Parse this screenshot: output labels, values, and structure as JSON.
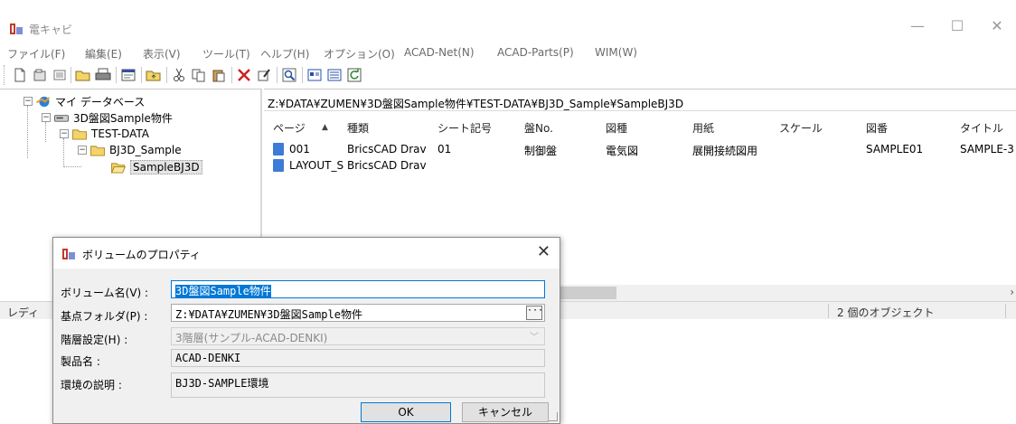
{
  "app": {
    "title": "電キャビ",
    "minimize": "—",
    "maximize": "☐",
    "close": "✕"
  },
  "menu": [
    "ファイル(F)",
    "編集(E)",
    "表示(V)",
    "ツール(T)",
    "ヘルプ(H)",
    "オプション(O)",
    "ACAD-Net(N)",
    "ACAD-Parts(P)",
    "WIM(W)"
  ],
  "toolbar_icons": [
    "new-file-icon",
    "open-icon",
    "list-icon",
    "open-folder-icon",
    "print-icon",
    "properties-icon",
    "folder-up-icon",
    "cut-icon",
    "copy-icon",
    "paste-icon",
    "delete-icon",
    "edit-properties-icon",
    "search-icon",
    "view-icon",
    "detail-view-icon",
    "refresh-icon"
  ],
  "tree": {
    "root": "マイ データベース",
    "volume": "3D盤図Sample物件",
    "folder1": "TEST-DATA",
    "folder2": "BJ3D_Sample",
    "folder3": "SampleBJ3D"
  },
  "list": {
    "path": "Z:¥DATA¥ZUMEN¥3D盤図Sample物件¥TEST-DATA¥BJ3D_Sample¥SampleBJ3D",
    "columns": [
      "ページ",
      "種類",
      "シート記号",
      "盤No.",
      "図種",
      "用紙",
      "スケール",
      "図番",
      "タイトル"
    ],
    "sort_indicator": "▲",
    "rows": [
      [
        "001",
        "BricsCAD Drav",
        "01",
        "制御盤",
        "電気図",
        "展開接続図用",
        "",
        "SAMPLE01",
        "SAMPLE-3"
      ],
      [
        "LAYOUT_S",
        "BricsCAD Drav",
        "",
        "",
        "",
        "",
        "",
        "",
        ""
      ]
    ],
    "scroll_arrow": "›"
  },
  "status": {
    "ready": "レディ",
    "count": "2 個のオブジェクト"
  },
  "dialog": {
    "title": "ボリュームのプロパティ",
    "close": "✕",
    "volume_name_label": "ボリューム名(V) :",
    "volume_name_value": "3D盤図Sample物件",
    "base_folder_label": "基点フォルダ(P) :",
    "base_folder_value": "Z:¥DATA¥ZUMEN¥3D盤図Sample物件",
    "browse_label": "···",
    "hierarchy_label": "階層設定(H) :",
    "hierarchy_value": "3階層(サンプル-ACAD-DENKI)",
    "combo_arrow": "﹀",
    "product_label": "製品名 :",
    "product_value": "ACAD-DENKI",
    "env_label": "環境の説明 :",
    "env_value": "BJ3D-SAMPLE環境",
    "ok": "OK",
    "cancel": "キャンセル"
  },
  "colors": {
    "selection": "#0078d7",
    "folder_yellow": "#f5d36b",
    "file_blue": "#3d7bd6"
  }
}
